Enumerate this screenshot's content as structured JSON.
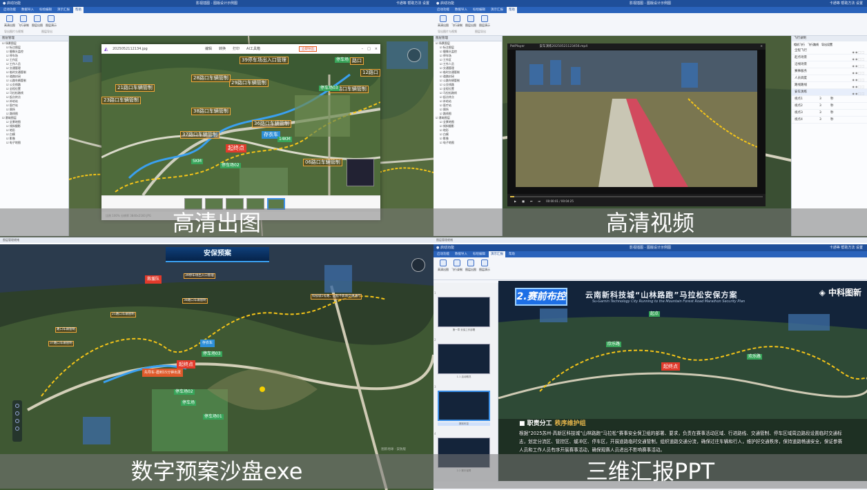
{
  "captions": {
    "q1": "高清出图",
    "q2": "高清视频",
    "q3": "数字预案沙盘exe",
    "q4": "三维汇报PPT"
  },
  "app": {
    "title": "影视插图 - 图版设计示例图",
    "menu": [
      "启动功能",
      "数据导入",
      "标绘编辑",
      "演示汇报",
      "帮助"
    ],
    "title_right": [
      "卡通等",
      "帮助方法",
      "设置"
    ],
    "ribbon_buttons": [
      "高清出图",
      "飞行录制",
      "图层出图",
      "图层演示"
    ],
    "ribbon_group_1": "导出图片与视频",
    "ribbon_group_2": "图层导出",
    "tree_header": "图层管理",
    "tree_items": [
      "场景图层",
      "标注图层",
      "摄像头监控",
      "停车场",
      "工作区",
      "工作人员",
      "交通管理",
      "临时交通管制",
      "道路封闭",
      "公路车辆管制",
      "公交线路",
      "全程位置",
      "马拉松路线",
      "起点终点",
      "补给站",
      "医疗站",
      "厕所",
      "路线图",
      "基础图层",
      "全景地图",
      "倾斜摄影",
      "地形",
      "白模",
      "影像",
      "电子地图"
    ],
    "status_text": "图层管理就绪"
  },
  "image_window": {
    "filename": "2025052112134.jpg",
    "tools": [
      "编辑",
      "转换",
      "打印",
      "AI工具箱"
    ],
    "button": "立即导出",
    "footer": "比例 100%  分辨率 3840x2160  JPG",
    "labels": [
      "39停车场出入口管理",
      "29路口车辆管制",
      "28路口车辆管制",
      "21路口车辆管制",
      "23路口车辆管制",
      "38路口车辆管制",
      "36路口车辆管制",
      "37路口车辆管制",
      "12路口",
      "33路口车辆管制",
      "停车场03",
      "起终点",
      "存衣车",
      "停车场02",
      "06路口车辆管制",
      "5KM",
      "14KM",
      "停车场",
      "路口"
    ]
  },
  "video": {
    "player": "PotPlayer",
    "file": "安车演练20250521123456.mp4",
    "time": "00:00:01 / 00:04:25",
    "panel_header": "飞行录制",
    "panel_tabs": [
      "相机飞行",
      "飞行路线",
      "导出设置"
    ],
    "panel_items": [
      "全程飞行",
      "起点场景",
      "沿线场景",
      "赛事服务",
      "人员调度",
      "路线路线",
      "安车演练"
    ],
    "params": [
      {
        "label": "视点1",
        "value": "3",
        "unit": "秒"
      },
      {
        "label": "视点2",
        "value": "3",
        "unit": "秒"
      },
      {
        "label": "视点3",
        "value": "3",
        "unit": "秒"
      },
      {
        "label": "视点4",
        "value": "3",
        "unit": "秒"
      }
    ]
  },
  "sandbox": {
    "title": "安保预案",
    "labels": [
      "救援队",
      "起终点",
      "先导车-遇到15分钟出发",
      "停车场03",
      "停车场02",
      "停车场",
      "停车场01",
      "存衣车",
      "路口车辆管制",
      "科技城1号路、过程不影响交通通行",
      "38路口车辆管制",
      "39停车场出入口管理",
      "21路口车辆管制",
      "37路口车辆管制"
    ],
    "watermark": "图新地球 · 安防版"
  },
  "ppt": {
    "slide_labels": [
      "第一章 安保工作部署",
      "1.1 活动概况",
      "赛前布控",
      "2.2 赛中保障"
    ],
    "chip": "2.赛前布控",
    "title_cn": "云南新科技城“山林路跑”马拉松安保方案",
    "title_en": "Su-Garnin Technology City Running to the Mountain Forest Road Marathon Security Plan",
    "brand": "中科图新",
    "section_head": "■ 职责分工",
    "section_sub": "秩序维护组",
    "paragraph": "根据“2025苏州·高新区科技城”山林路跑“马拉松”赛事安全保卫组的部署、要求，负责在赛事活动区域、行进路线、交通管制、停车区域周边路段设置临时交通标志，划定分流区、管控区、缓冲区、停车区，开展道路临时交通管制，组织道路交通分流，确保过往车辆和行人，维护好交通秩序，保持道路畅通安全，保证参赛人员和工作人员有序开展赛事活动，确保观赛人员进出不影响赛事活动。",
    "labels": [
      "起终点",
      "欣乐路",
      "欢乐路",
      "起点"
    ]
  },
  "colors": {
    "title_blue": "#1f4f9a",
    "menu_blue": "#2a63bb",
    "label_orange": "#f2a93b",
    "route_yellow": "#f5c518",
    "marker_blue": "#3a8fe8"
  }
}
